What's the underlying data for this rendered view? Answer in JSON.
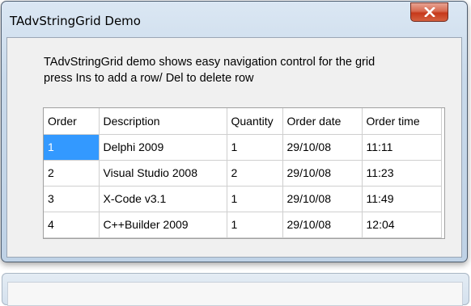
{
  "window": {
    "title": "TAdvStringGrid Demo"
  },
  "description": {
    "line1": "TAdvStringGrid demo shows easy navigation control for the grid",
    "line2": "press Ins to add a row/ Del to delete row"
  },
  "grid": {
    "columns": [
      "Order",
      "Description",
      "Quantity",
      "Order date",
      "Order time"
    ],
    "rows": [
      [
        "1",
        "Delphi 2009",
        "1",
        "29/10/08",
        "11:11"
      ],
      [
        "2",
        "Visual Studio 2008",
        "2",
        "29/10/08",
        "11:23"
      ],
      [
        "3",
        "X-Code v3.1",
        "1",
        "29/10/08",
        "11:49"
      ],
      [
        "4",
        "C++Builder 2009",
        "1",
        "29/10/08",
        "12:04"
      ]
    ],
    "selected_cell": "row 1, Order",
    "selection_color": "#3399ff"
  },
  "icons": {
    "close": "close-icon"
  }
}
